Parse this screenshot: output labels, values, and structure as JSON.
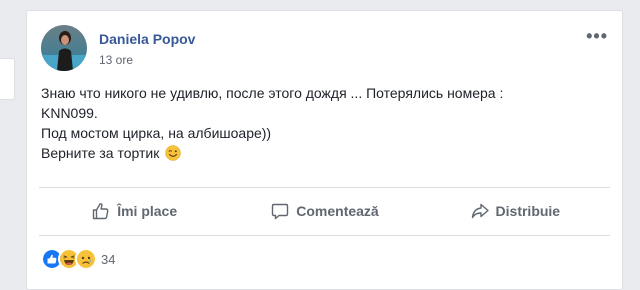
{
  "post": {
    "author": "Daniela Popov",
    "time": "13 ore",
    "more_label": "•••",
    "lines": [
      "Знаю что никого не удивлю, после этого дождя ... Потерялись номера :",
      "KNN099.",
      "Под мостом цирка, на албишоаре))",
      "Верните за тортик"
    ],
    "inline_emoji": "wink-emoji"
  },
  "actions": {
    "like": "Îmi place",
    "comment": "Comentează",
    "share": "Distribuie"
  },
  "reactions": {
    "types": [
      "like-reaction-icon",
      "haha-reaction-icon",
      "sad-reaction-icon"
    ],
    "count": "34"
  },
  "colors": {
    "author": "#385898",
    "like_blue": "#1877f2",
    "emoji_yellow": "#f7c23a"
  }
}
